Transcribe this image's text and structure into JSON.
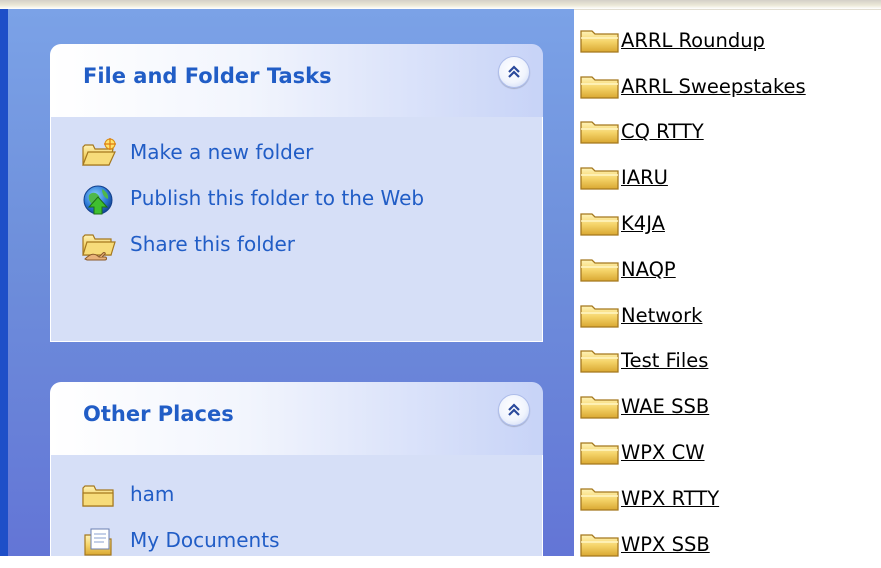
{
  "task_pane": {
    "file_folder_tasks": {
      "title": "File and Folder Tasks",
      "tasks": [
        {
          "label": "Make a new folder",
          "icon": "new-folder-icon"
        },
        {
          "label": "Publish this folder to the Web",
          "icon": "publish-web-icon"
        },
        {
          "label": "Share this folder",
          "icon": "share-folder-icon"
        }
      ]
    },
    "other_places": {
      "title": "Other Places",
      "places": [
        {
          "label": "ham",
          "icon": "folder-icon"
        },
        {
          "label": "My Documents",
          "icon": "my-documents-icon"
        }
      ]
    }
  },
  "folders": [
    "ARRL Roundup",
    "ARRL Sweepstakes",
    "CQ RTTY",
    "IARU",
    "K4JA",
    "NAQP",
    "Network",
    "Test Files",
    "WAE SSB",
    "WPX CW",
    "WPX RTTY",
    "WPX SSB"
  ],
  "colors": {
    "task_pane_top": "#7ba2e7",
    "task_pane_bottom": "#6375d6",
    "panel_body": "#d6dff7",
    "link_blue": "#215dc6",
    "folder_yellow": "#f5d76e"
  }
}
